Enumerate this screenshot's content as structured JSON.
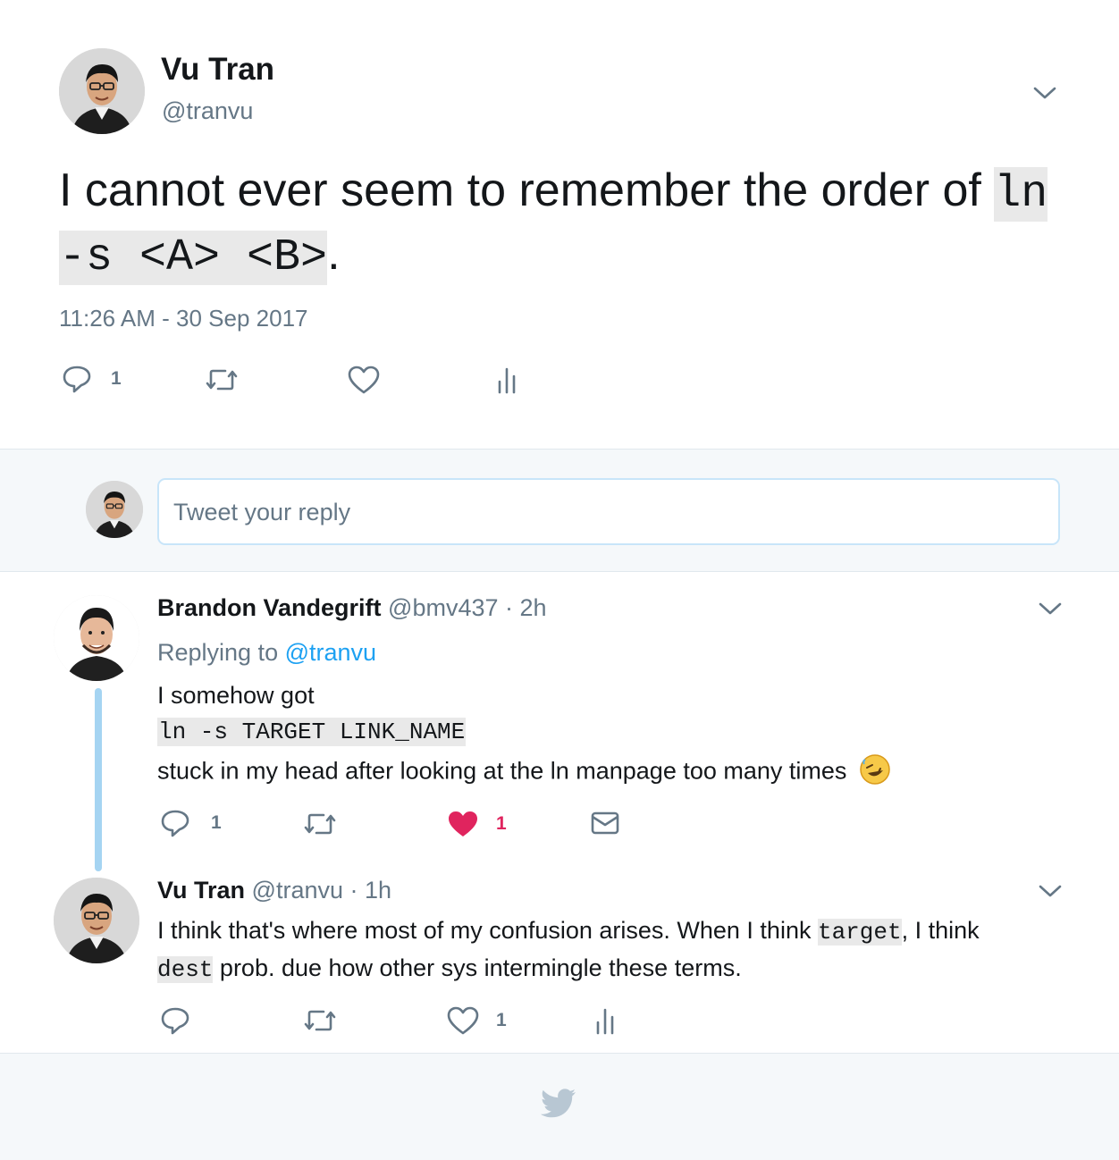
{
  "main_tweet": {
    "author_name": "Vu Tran",
    "author_handle": "@tranvu",
    "text_prefix": "I cannot ever seem to remember the order of ",
    "code": "ln -s <A> <B>",
    "text_suffix": ".",
    "timestamp": "11:26 AM - 30 Sep 2017",
    "reply_count": "1",
    "icons": [
      "reply-icon",
      "retweet-icon",
      "like-icon",
      "analytics-icon",
      "chevron-down-icon"
    ]
  },
  "reply_box": {
    "placeholder": "Tweet your reply"
  },
  "replies": [
    {
      "author_name": "Brandon Vandegrift",
      "author_handle": "@bmv437",
      "time": "· 2h",
      "replying_to_prefix": "Replying to ",
      "replying_to_handle": "@tranvu",
      "line1": "I somehow got",
      "code": "ln -s TARGET LINK_NAME",
      "line3": "stuck in my head after looking at the ln manpage too many times",
      "emoji": "🤣",
      "reply_count": "1",
      "like_count": "1",
      "icons": [
        "reply-icon",
        "retweet-icon",
        "heart-filled-icon",
        "envelope-icon"
      ]
    },
    {
      "author_name": "Vu Tran",
      "author_handle": "@tranvu",
      "time": "· 1h",
      "text_a": "I think that's where most of my confusion arises. When I think ",
      "code_a": "target",
      "text_b": ", I think",
      "code_b": "dest",
      "text_c": " prob. due how other sys intermingle these terms.",
      "like_count": "1",
      "icons": [
        "reply-icon",
        "retweet-icon",
        "like-icon",
        "analytics-icon"
      ]
    }
  ],
  "footer": {
    "icon": "twitter-bird-icon"
  },
  "colors": {
    "link": "#1da1f2",
    "muted": "#657786",
    "like": "#e0245e",
    "thread_line": "#a5d4f2",
    "panel_bg": "#f5f8fa",
    "border": "#e6ecf0"
  }
}
